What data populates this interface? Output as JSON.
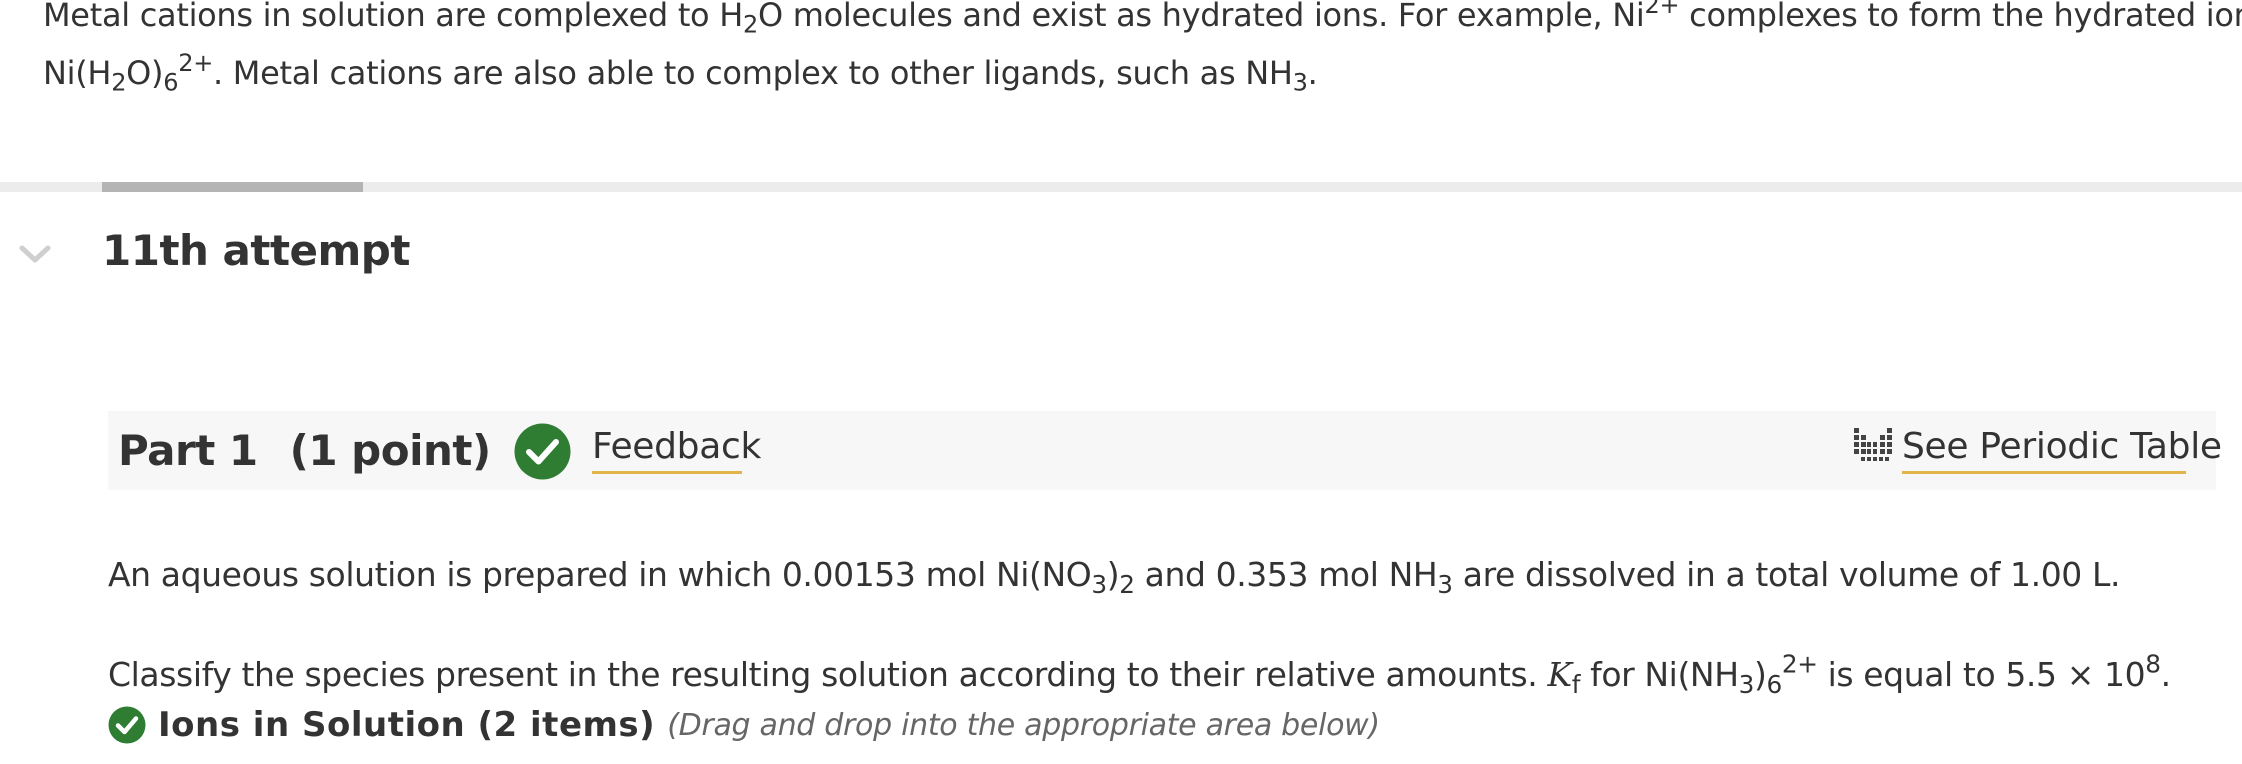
{
  "intro": {
    "line1_a": "Metal cations in solution are complexed to H",
    "line1_sub": "2",
    "line1_b": "O molecules and exist as hydrated ions. For example, Ni",
    "line1_sup": "2+",
    "line1_c": " complexes to form the hydrated ion",
    "line2_a": "Ni(H",
    "line2_sub1": "2",
    "line2_b": "O)",
    "line2_sub2": "6",
    "line2_sup": "2+",
    "line2_c": ". Metal cations are also able to complex to other ligands, such as NH",
    "line2_sub3": "3",
    "line2_d": "."
  },
  "attempt": {
    "label": "11th attempt"
  },
  "part": {
    "title": "Part 1",
    "points": "(1 point)",
    "feedback_label": "Feedback",
    "periodic_table_label": "See Periodic Table"
  },
  "question": {
    "q1_a": "An aqueous solution is prepared in which 0.00153 mol Ni(NO",
    "q1_sub1": "3",
    "q1_b": ")",
    "q1_sub2": "2",
    "q1_c": " and 0.353  mol NH",
    "q1_sub3": "3",
    "q1_d": " are dissolved in a total volume of 1.00 L.",
    "q2_a": "Classify the species present in the resulting solution according to their relative amounts. ",
    "q2_k": "K",
    "q2_ksub": "f",
    "q2_b": " for Ni(NH",
    "q2_sub1": "3",
    "q2_c": ")",
    "q2_sub2": "6",
    "q2_sup1": "2+",
    "q2_d": " is equal to 5.5 × 10",
    "q2_sup2": "8",
    "q2_e": "."
  },
  "items": {
    "title": "Ions in Solution (2 items)",
    "hint": "(Drag and drop into the appropriate area below)"
  },
  "colors": {
    "success_green": "#2e7d32",
    "underline_gold": "#e2b548",
    "track_fill": "#b4b4b4"
  },
  "icons": {
    "collapse": "chevron-down-icon",
    "status": "check-circle-icon",
    "periodic_table": "periodic-table-icon"
  }
}
